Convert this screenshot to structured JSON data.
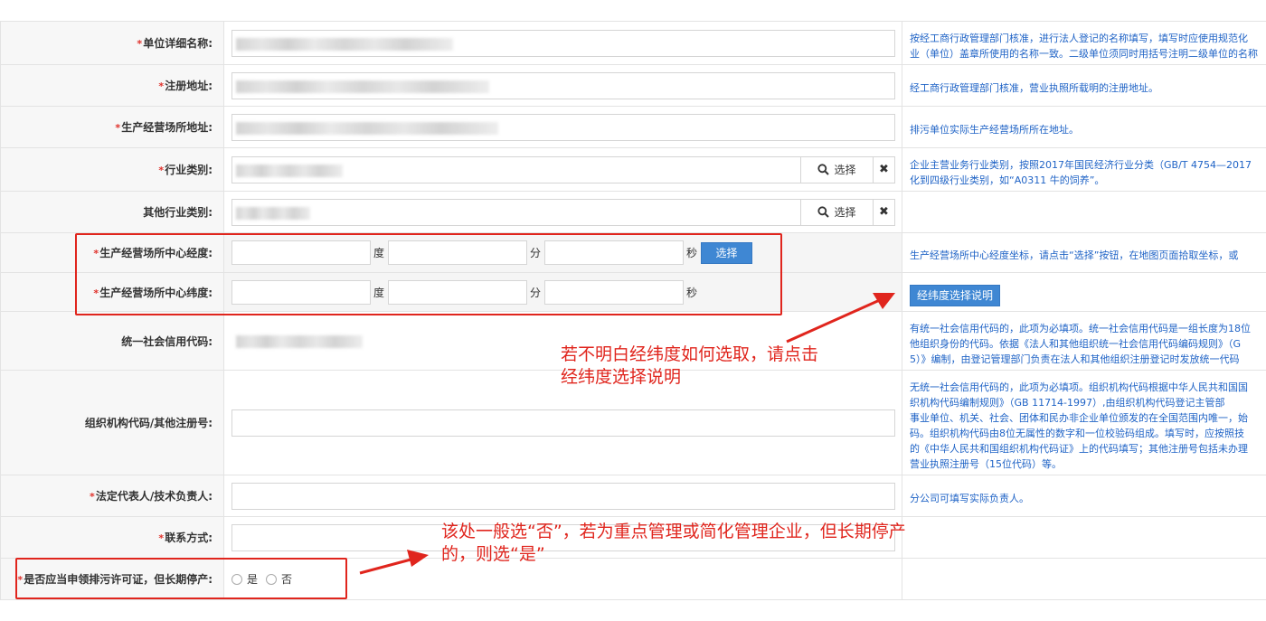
{
  "rows": {
    "unit_name": {
      "label": "单位详细名称:",
      "help_line1": "按经工商行政管理部门核准，进行法人登记的名称填写，填写时应使用规范化",
      "help_line2": "业（单位）盖章所使用的名称一致。二级单位须同时用括号注明二级单位的名称"
    },
    "reg_address": {
      "label": "注册地址:",
      "help_line1": "经工商行政管理部门核准，营业执照所载明的注册地址。"
    },
    "site_address": {
      "label": "生产经营场所地址:",
      "help_line1": "排污单位实际生产经营场所所在地址。"
    },
    "industry": {
      "label": "行业类别:",
      "select_label": "选择",
      "help_line1": "企业主营业务行业类别，按照2017年国民经济行业分类（GB/T 4754—2017",
      "help_line2": "化到四级行业类别，如“A0311 牛的饲养”。"
    },
    "other_industry": {
      "label": "其他行业类别:",
      "select_label": "选择"
    },
    "longitude": {
      "label": "生产经营场所中心经度:",
      "unit_deg": "度",
      "unit_min": "分",
      "unit_sec": "秒",
      "select_label": "选择",
      "help_line1": "生产经营场所中心经度坐标，请点击“选择”按钮，在地图页面拾取坐标，或"
    },
    "latitude": {
      "label": "生产经营场所中心纬度:",
      "unit_deg": "度",
      "unit_min": "分",
      "unit_sec": "秒",
      "help_button": "经纬度选择说明"
    },
    "credit_code": {
      "label": "统一社会信用代码:",
      "help_line1": "有统一社会信用代码的，此项为必填项。统一社会信用代码是一组长度为18位",
      "help_line2": "他组织身份的代码。依据《法人和其他组织统一社会信用代码编码规则》（G",
      "help_line3": "5）》编制，由登记管理部门负责在法人和其他组织注册登记时发放统一代码"
    },
    "org_code": {
      "label": "组织机构代码/其他注册号:",
      "help_line1": "无统一社会信用代码的，此项为必填项。组织机构代码根据中华人民共和国国",
      "help_line2": "织机构代码编制规则》（GB 11714-1997）,由组织机构代码登记主管部",
      "help_line3": "事业单位、机关、社会、团体和民办非企业单位颁发的在全国范围内唯一，始",
      "help_line4": "码。组织机构代码由8位无属性的数字和一位校验码组成。填写时，应按照技",
      "help_line5": "的《中华人民共和国组织机构代码证》上的代码填写；其他注册号包括未办理",
      "help_line6": "营业执照注册号（15位代码）等。"
    },
    "legal_rep": {
      "label": "法定代表人/技术负责人:",
      "help_line1": "分公司可填写实际负责人。"
    },
    "contact": {
      "label": "联系方式:"
    },
    "long_term_stop": {
      "label": "是否应当申领排污许可证，但长期停产:",
      "option_yes": "是",
      "option_no": "否"
    }
  },
  "annotations": {
    "coord_hint_line1": "若不明白经纬度如何选取，请点击",
    "coord_hint_line2": "经纬度选择说明",
    "stop_hint_line1": "该处一般选“否”，若为重点管理或简化管理企业，但长期停产",
    "stop_hint_line2": "的，则选“是”",
    "color": "#e0251d"
  },
  "colors": {
    "required_star": "#e0312b",
    "help_text": "#1f63c6",
    "primary_button": "#3f87d3",
    "label_bg": "#f7f7f7"
  },
  "icons": {
    "search": "magnifier-icon",
    "clear": "close-x-icon"
  }
}
